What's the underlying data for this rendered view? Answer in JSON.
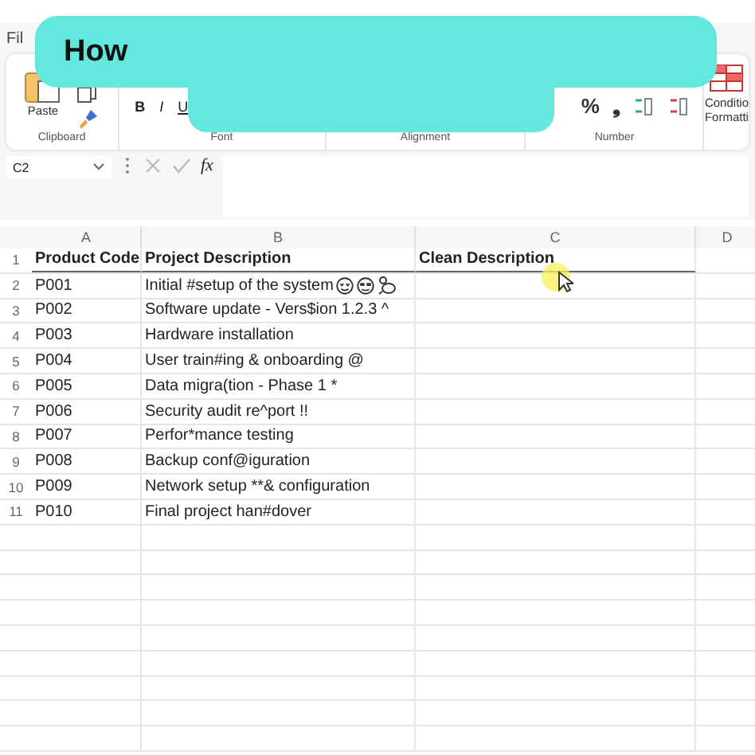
{
  "ribbon": {
    "tab": "Fil",
    "paste": "Paste",
    "font_buttons": [
      "B",
      "I",
      "U"
    ],
    "number_buttons": [
      "%",
      "❟"
    ],
    "conditional_formatting": [
      "Conditio",
      "Formatti"
    ],
    "group_labels": [
      "Clipboard",
      "Font",
      "Alignment",
      "Number"
    ]
  },
  "banner": {
    "title": "How"
  },
  "formula_bar": {
    "name_box": "C2",
    "fx": "fx"
  },
  "sheet": {
    "columns": [
      "A",
      "B",
      "C",
      "D"
    ],
    "rows": [
      {
        "num": "1",
        "header": true,
        "cells": [
          "Product Code",
          "Project Description",
          "Clean Description"
        ]
      },
      {
        "num": "2",
        "header": false,
        "cells": [
          "P001",
          "Initial #setup of the system",
          ""
        ],
        "icons": [
          {
            "kind": "heart-eyes"
          },
          {
            "kind": "sunglasses"
          },
          {
            "kind": "mouse"
          }
        ]
      },
      {
        "num": "3",
        "header": false,
        "cells": [
          "P002",
          "Software update - Vers$ion 1.2.3 ^",
          ""
        ]
      },
      {
        "num": "4",
        "header": false,
        "cells": [
          "P003",
          "Hardware installation",
          ""
        ]
      },
      {
        "num": "5",
        "header": false,
        "cells": [
          "P004",
          "User train#ing & onboarding @",
          ""
        ]
      },
      {
        "num": "6",
        "header": false,
        "cells": [
          "P005",
          "Data migra(tion - Phase 1 *",
          ""
        ]
      },
      {
        "num": "7",
        "header": false,
        "cells": [
          "P006",
          "Security audit re^port !!",
          ""
        ]
      },
      {
        "num": "8",
        "header": false,
        "cells": [
          "P007",
          "Perfor*mance testing",
          ""
        ]
      },
      {
        "num": "9",
        "header": false,
        "cells": [
          "P008",
          "Backup conf@iguration",
          ""
        ]
      },
      {
        "num": "10",
        "header": false,
        "cells": [
          "P009",
          "Network setup **& configuration",
          ""
        ]
      },
      {
        "num": "11",
        "header": false,
        "cells": [
          "P010",
          "Final project han#dover",
          ""
        ]
      }
    ]
  }
}
